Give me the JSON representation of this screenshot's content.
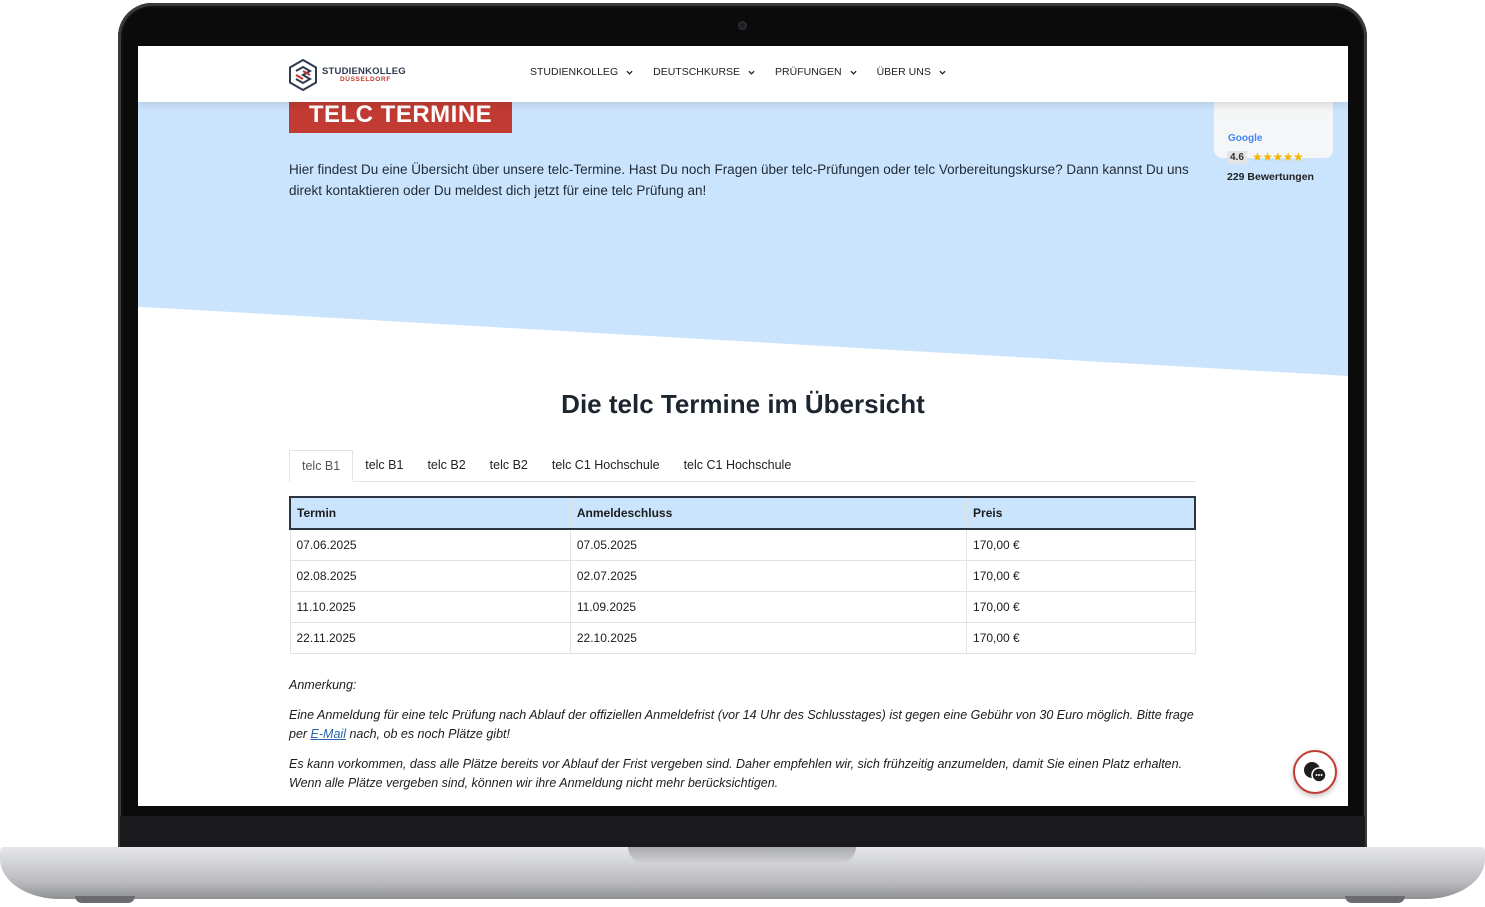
{
  "header": {
    "logo_title": "STUDIENKOLLEG",
    "logo_sub": "DÜSSELDORF",
    "nav": [
      {
        "label": "STUDIENKOLLEG"
      },
      {
        "label": "DEUTSCHKURSE"
      },
      {
        "label": "PRÜFUNGEN"
      },
      {
        "label": "ÜBER UNS"
      }
    ]
  },
  "hero": {
    "title": "TELC TERMINE",
    "intro": "Hier findest Du eine Übersicht über unsere telc-Termine. Hast Du noch Fragen über telc-Prüfungen oder telc Vorbereitungskurse? Dann kannst Du uns direkt kontaktieren oder Du meldest dich jetzt für eine telc Prüfung an!"
  },
  "rating": {
    "brand": "Google",
    "score": "4.6",
    "stars": "★★★★★",
    "count": "229 Bewertungen"
  },
  "section": {
    "title": "Die telc Termine im Übersicht",
    "tabs": [
      {
        "label": "telc B1"
      },
      {
        "label": "telc B1"
      },
      {
        "label": "telc B2"
      },
      {
        "label": "telc B2"
      },
      {
        "label": "telc C1 Hochschule"
      },
      {
        "label": "telc C1 Hochschule"
      }
    ],
    "table": {
      "headers": [
        "Termin",
        "Anmeldeschluss",
        "Preis"
      ],
      "rows": [
        [
          "07.06.2025",
          "07.05.2025",
          "170,00 €"
        ],
        [
          "02.08.2025",
          "02.07.2025",
          "170,00 €"
        ],
        [
          "11.10.2025",
          "11.09.2025",
          "170,00 €"
        ],
        [
          "22.11.2025",
          "22.10.2025",
          "170,00 €"
        ]
      ]
    }
  },
  "notes": {
    "heading": "Anmerkung:",
    "p1_before": "Eine Anmeldung für eine telc Prüfung nach Ablauf der offiziellen Anmeldefrist (vor 14 Uhr des Schlusstages) ist gegen eine Gebühr von 30 Euro möglich. Bitte frage per ",
    "p1_link": "E-Mail",
    "p1_after": " nach, ob es noch Plätze gibt!",
    "p2": "Es kann vorkommen, dass alle Plätze bereits vor Ablauf der Frist vergeben sind. Daher empfehlen wir, sich frühzeitig anzumelden, damit Sie einen Platz erhalten. Wenn alle Plätze vergeben sind, können wir ihre Anmeldung nicht mehr berücksichtigen."
  },
  "colors": {
    "accent_red": "#c23b33",
    "hero_blue": "#cbe4fd",
    "dark_text": "#1c2530"
  }
}
